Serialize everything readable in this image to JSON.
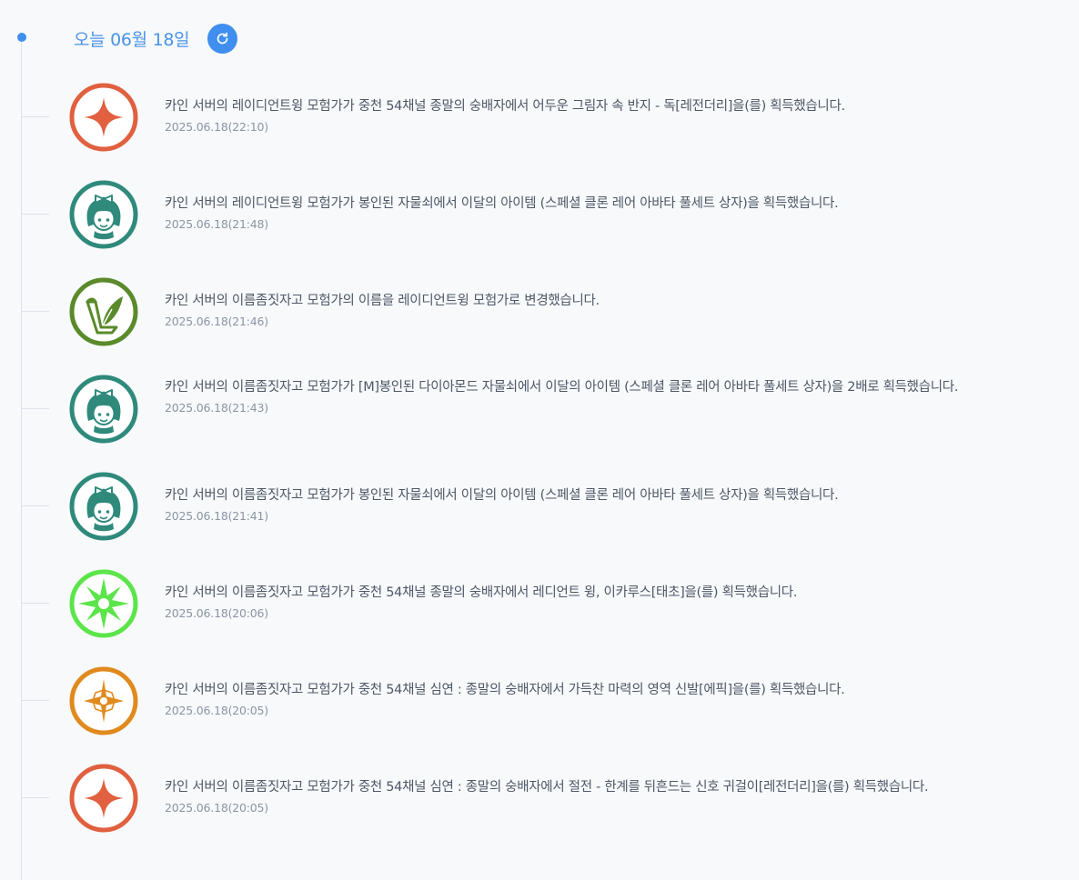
{
  "header": {
    "date_title": "오늘 06월 18일"
  },
  "colors": {
    "accent": "#3f8ef0",
    "legendary": "#e0603f",
    "hair": "#2f8a7c",
    "rename": "#5a8a2a",
    "unique": "#5ce54a",
    "epic": "#e08a1e"
  },
  "entries": [
    {
      "icon": "legendary-star-icon",
      "message": "카인 서버의 레이디언트윙 모험가가 중천 54채널 종말의 숭배자에서 어두운 그림자 속 반지 - 독[레전더리]을(를) 획득했습니다.",
      "timestamp": "2025.06.18(22:10)"
    },
    {
      "icon": "avatar-girl-icon",
      "message": "카인 서버의 레이디언트윙 모험가가 봉인된 자물쇠에서 이달의 아이템 (스페셜 클론 레어 아바타 풀세트 상자)을 획득했습니다.",
      "timestamp": "2025.06.18(21:48)"
    },
    {
      "icon": "rename-quill-icon",
      "message": "카인 서버의 이름좀짓자고 모험가의 이름을 레이디언트윙 모험가로 변경했습니다.",
      "timestamp": "2025.06.18(21:46)"
    },
    {
      "icon": "avatar-girl-icon",
      "message": "카인 서버의 이름좀짓자고 모험가가 [M]봉인된 다이아몬드 자물쇠에서 이달의 아이템 (스페셜 클론 레어 아바타 풀세트 상자)을 2배로 획득했습니다.",
      "timestamp": "2025.06.18(21:43)"
    },
    {
      "icon": "avatar-girl-icon",
      "message": "카인 서버의 이름좀짓자고 모험가가 봉인된 자물쇠에서 이달의 아이템 (스페셜 클론 레어 아바타 풀세트 상자)을 획득했습니다.",
      "timestamp": "2025.06.18(21:41)"
    },
    {
      "icon": "taecho-burst-icon",
      "message": "카인 서버의 이름좀짓자고 모험가가 중천 54채널 종말의 숭배자에서 레디언트 윙, 이카루스[태초]을(를) 획득했습니다.",
      "timestamp": "2025.06.18(20:06)"
    },
    {
      "icon": "epic-star-icon",
      "message": "카인 서버의 이름좀짓자고 모험가가 중천 54채널 심연 : 종말의 숭배자에서 가득찬 마력의 영역 신발[에픽]을(를) 획득했습니다.",
      "timestamp": "2025.06.18(20:05)"
    },
    {
      "icon": "legendary-star-icon",
      "message": "카인 서버의 이름좀짓자고 모험가가 중천 54채널 심연 : 종말의 숭배자에서 절전 - 한계를 뒤흔드는 신호 귀걸이[레전더리]을(를) 획득했습니다.",
      "timestamp": "2025.06.18(20:05)"
    }
  ]
}
